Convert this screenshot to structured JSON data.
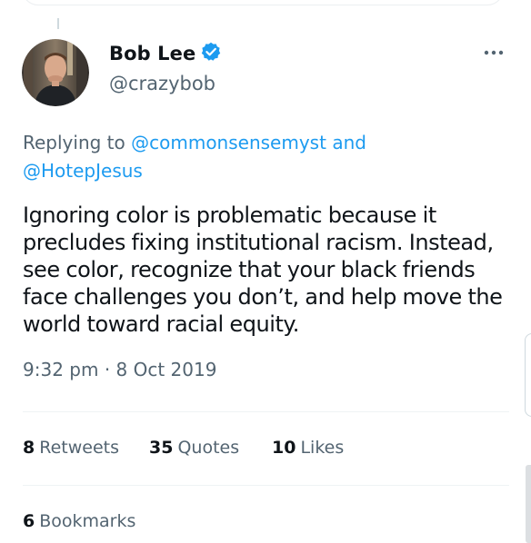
{
  "author": {
    "display_name": "Bob Lee",
    "handle": "@crazybob",
    "verified": true,
    "avatar_icon": "profile-photo",
    "verified_icon": "verified-badge-icon",
    "verified_color": "#1d9bf0"
  },
  "menu": {
    "more_icon": "more-horizontal-icon"
  },
  "reply": {
    "prefix": "Replying to",
    "mention_1": "@commonsensemyst",
    "conjunction": "and",
    "mention_2": "@HotepJesus"
  },
  "tweet": {
    "text": "Ignoring color is problematic because it precludes fixing institutional racism. Instead, see color, recognize that your black friends face challenges you don’t, and help move the world toward racial equity."
  },
  "meta": {
    "time": "9:32 pm",
    "separator": "·",
    "date": "8 Oct 2019"
  },
  "stats": {
    "retweets_count": "8",
    "retweets_label": "Retweets",
    "quotes_count": "35",
    "quotes_label": "Quotes",
    "likes_count": "10",
    "likes_label": "Likes",
    "bookmarks_count": "6",
    "bookmarks_label": "Bookmarks"
  },
  "colors": {
    "text_primary": "#0f1419",
    "text_secondary": "#536471",
    "link": "#1d9bf0",
    "divider": "#eff3f4"
  }
}
